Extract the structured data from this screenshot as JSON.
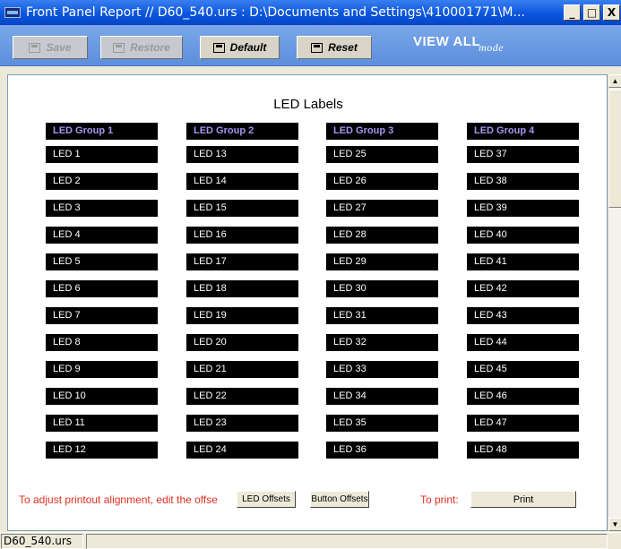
{
  "window": {
    "title": "Front Panel Report // D60_540.urs : D:\\Documents and Settings\\410001771\\M...",
    "minimize": "_",
    "maximize": "□",
    "close": "X"
  },
  "toolbar": {
    "save_label": "Save",
    "restore_label": "Restore",
    "default_label": "Default",
    "reset_label": "Reset",
    "view_all_label": "VIEW ALL",
    "view_all_mode": "mode"
  },
  "report": {
    "title": "LED Labels",
    "groups": [
      {
        "header": "LED Group 1",
        "leds": [
          "LED 1",
          "LED 2",
          "LED 3",
          "LED 4",
          "LED 5",
          "LED 6",
          "LED 7",
          "LED 8",
          "LED 9",
          "LED 10",
          "LED 11",
          "LED 12"
        ]
      },
      {
        "header": "LED Group 2",
        "leds": [
          "LED 13",
          "LED 14",
          "LED 15",
          "LED 16",
          "LED 17",
          "LED 18",
          "LED 19",
          "LED 20",
          "LED 21",
          "LED 22",
          "LED 23",
          "LED 24"
        ]
      },
      {
        "header": "LED Group 3",
        "leds": [
          "LED 25",
          "LED 26",
          "LED 27",
          "LED 28",
          "LED 29",
          "LED 30",
          "LED 31",
          "LED 32",
          "LED 33",
          "LED 34",
          "LED 35",
          "LED 36"
        ]
      },
      {
        "header": "LED Group 4",
        "leds": [
          "LED 37",
          "LED 38",
          "LED 39",
          "LED 40",
          "LED 41",
          "LED 42",
          "LED 43",
          "LED 44",
          "LED 45",
          "LED 46",
          "LED 47",
          "LED 48"
        ]
      }
    ],
    "footer_text": "To adjust printout alignment, edit the offse",
    "led_offsets_label": "LED Offsets",
    "button_offsets_label": "Button Offsets",
    "to_print_label": "To print:",
    "print_label": "Print"
  },
  "status": {
    "file": "D60_540.urs"
  },
  "colors": {
    "title_bar": "#0a55dd",
    "toolbar": "#6a9ae2",
    "led_header_text": "#a995f2",
    "footer_text": "#e03020"
  }
}
